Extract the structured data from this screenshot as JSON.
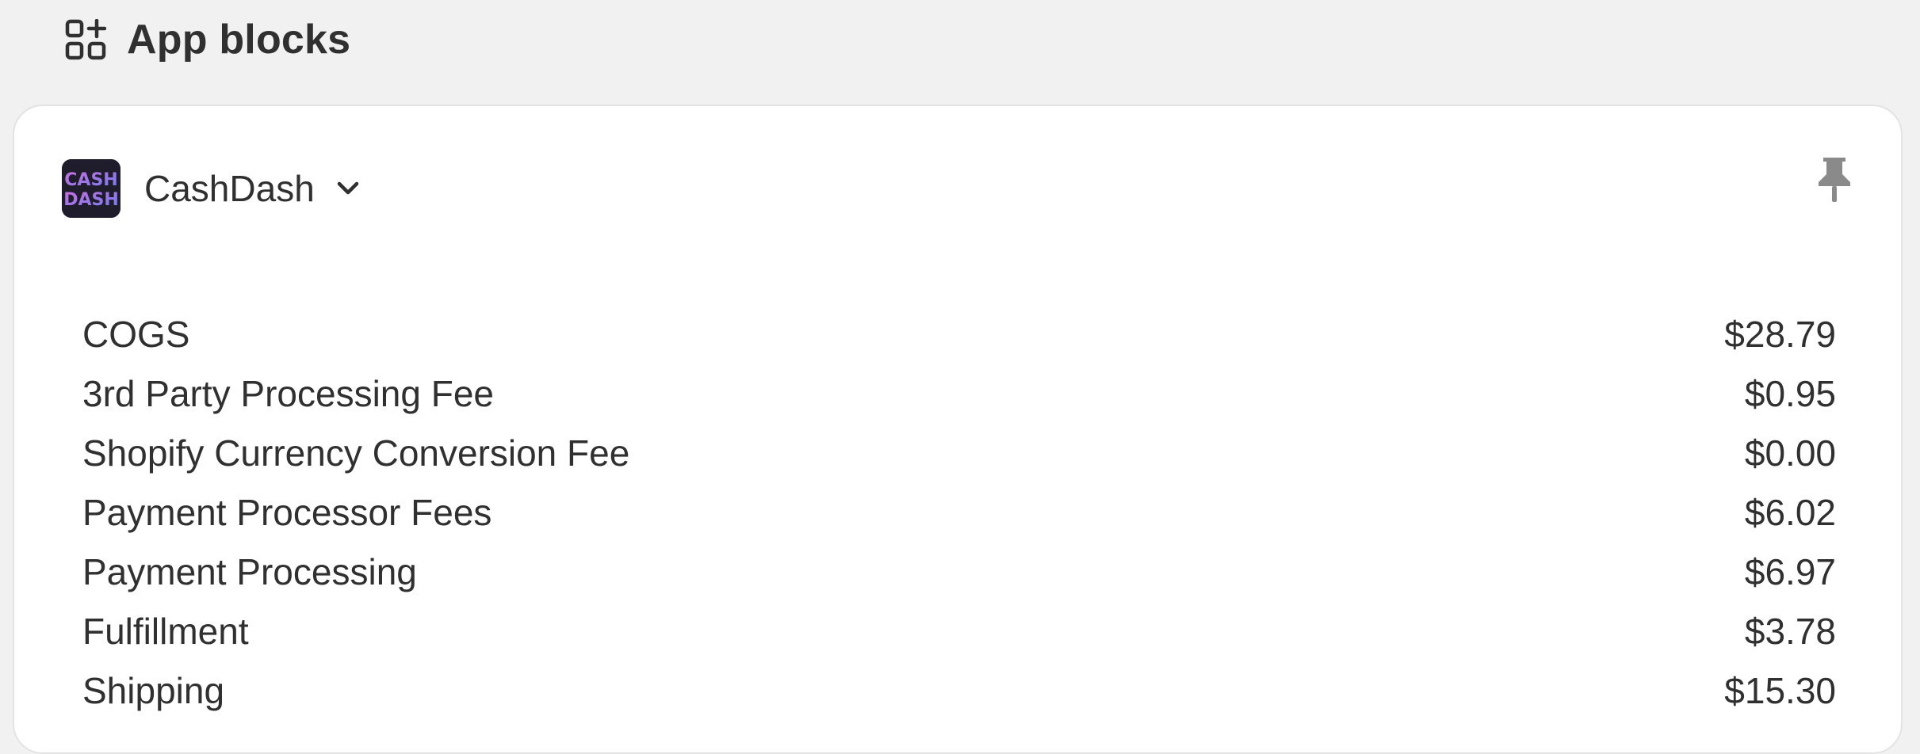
{
  "header": {
    "icon": "app-blocks-icon",
    "title": "App blocks"
  },
  "app": {
    "name": "CashDash",
    "logo": "cashdash-logo",
    "logo_text": "CASH DASH",
    "chevron_icon": "chevron-down-icon",
    "pin_icon": "pin-icon"
  },
  "fees": [
    {
      "label": "COGS",
      "value": "$28.79"
    },
    {
      "label": "3rd Party Processing Fee",
      "value": "$0.95"
    },
    {
      "label": "Shopify Currency Conversion Fee",
      "value": "$0.00"
    },
    {
      "label": "Payment Processor Fees",
      "value": "$6.02"
    },
    {
      "label": "Payment Processing",
      "value": "$6.97"
    },
    {
      "label": "Fulfillment",
      "value": "$3.78"
    },
    {
      "label": "Shipping",
      "value": "$15.30"
    }
  ],
  "colors": {
    "background": "#f1f1f1",
    "card": "#ffffff",
    "text": "#303030",
    "icon_gray": "#8a8a8a"
  }
}
